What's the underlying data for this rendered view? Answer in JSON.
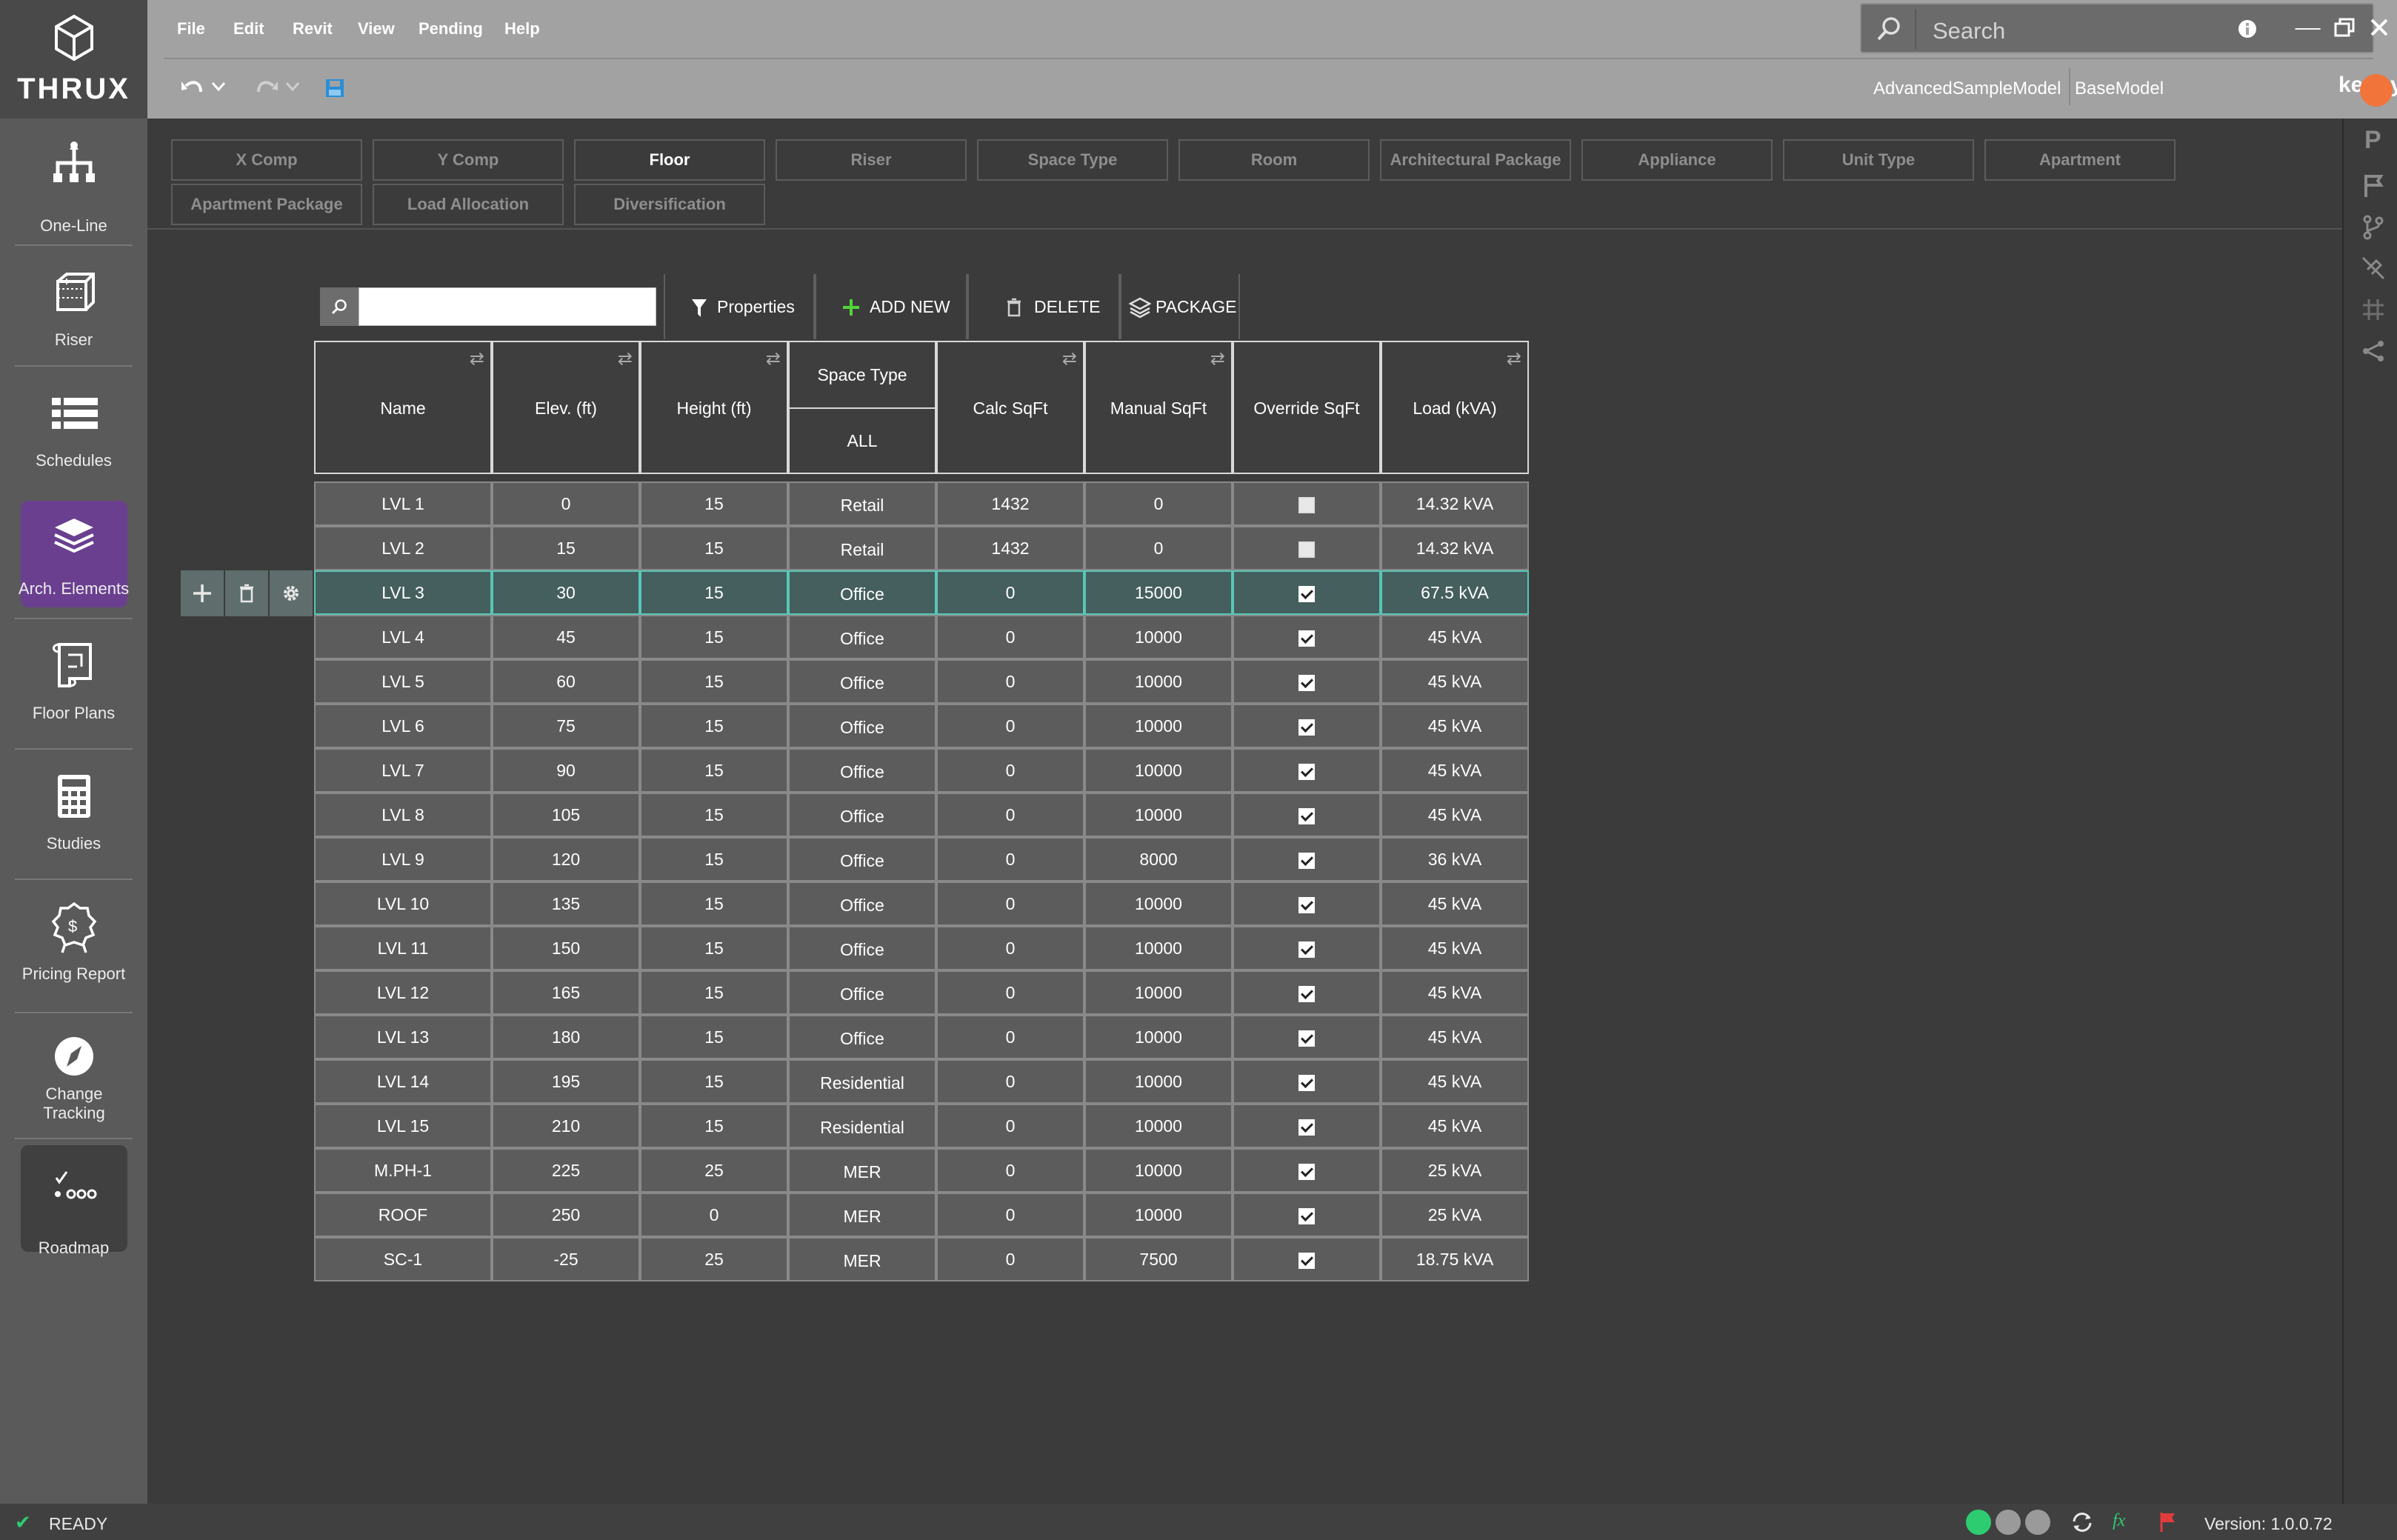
{
  "app": {
    "brand": "THRUX",
    "menu": [
      "File",
      "Edit",
      "Revit",
      "View",
      "Pending",
      "Help"
    ],
    "search_placeholder": "Search",
    "models": [
      "AdvancedSampleModel",
      "BaseModel"
    ],
    "user": "kennytanggg",
    "accent": "#6a3f8f",
    "selection_color": "#59c6b6"
  },
  "sidebar": [
    {
      "label": "One-Line",
      "icon": "one-line-icon"
    },
    {
      "label": "Riser",
      "icon": "riser-icon"
    },
    {
      "label": "Schedules",
      "icon": "schedules-icon"
    },
    {
      "label": "Arch. Elements",
      "icon": "arch-elements-icon",
      "active": true
    },
    {
      "label": "Floor Plans",
      "icon": "floor-plans-icon"
    },
    {
      "label": "Studies",
      "icon": "calculator-icon"
    },
    {
      "label": "Pricing Report",
      "icon": "pricing-report-icon"
    },
    {
      "label": "Change Tracking",
      "icon": "compass-icon"
    },
    {
      "label": "Roadmap",
      "icon": "roadmap-icon"
    }
  ],
  "tabs": {
    "row1": [
      "X Comp",
      "Y Comp",
      "Floor",
      "Riser",
      "Space Type",
      "Room",
      "Architectural Package",
      "Appliance",
      "Unit Type",
      "Apartment"
    ],
    "row2": [
      "Apartment Package",
      "Load Allocation",
      "Diversification"
    ],
    "active": "Floor"
  },
  "toolbar": {
    "properties": "Properties",
    "add_new": "ADD NEW",
    "delete": "DELETE",
    "package": "PACKAGE"
  },
  "table": {
    "columns": [
      "Name",
      "Elev. (ft)",
      "Height (ft)",
      "Space Type",
      "Calc SqFt",
      "Manual SqFt",
      "Override SqFt",
      "Load (kVA)"
    ],
    "space_type_filter": "ALL",
    "selected_row": 2,
    "rows": [
      {
        "name": "LVL 1",
        "elev": "0",
        "height": "15",
        "space": "Retail",
        "calc": "1432",
        "manual": "0",
        "override": false,
        "load": "14.32 kVA"
      },
      {
        "name": "LVL 2",
        "elev": "15",
        "height": "15",
        "space": "Retail",
        "calc": "1432",
        "manual": "0",
        "override": false,
        "load": "14.32 kVA"
      },
      {
        "name": "LVL 3",
        "elev": "30",
        "height": "15",
        "space": "Office",
        "calc": "0",
        "manual": "15000",
        "override": true,
        "load": "67.5 kVA"
      },
      {
        "name": "LVL 4",
        "elev": "45",
        "height": "15",
        "space": "Office",
        "calc": "0",
        "manual": "10000",
        "override": true,
        "load": "45 kVA"
      },
      {
        "name": "LVL 5",
        "elev": "60",
        "height": "15",
        "space": "Office",
        "calc": "0",
        "manual": "10000",
        "override": true,
        "load": "45 kVA"
      },
      {
        "name": "LVL 6",
        "elev": "75",
        "height": "15",
        "space": "Office",
        "calc": "0",
        "manual": "10000",
        "override": true,
        "load": "45 kVA"
      },
      {
        "name": "LVL 7",
        "elev": "90",
        "height": "15",
        "space": "Office",
        "calc": "0",
        "manual": "10000",
        "override": true,
        "load": "45 kVA"
      },
      {
        "name": "LVL 8",
        "elev": "105",
        "height": "15",
        "space": "Office",
        "calc": "0",
        "manual": "10000",
        "override": true,
        "load": "45 kVA"
      },
      {
        "name": "LVL 9",
        "elev": "120",
        "height": "15",
        "space": "Office",
        "calc": "0",
        "manual": "8000",
        "override": true,
        "load": "36 kVA"
      },
      {
        "name": "LVL 10",
        "elev": "135",
        "height": "15",
        "space": "Office",
        "calc": "0",
        "manual": "10000",
        "override": true,
        "load": "45 kVA"
      },
      {
        "name": "LVL 11",
        "elev": "150",
        "height": "15",
        "space": "Office",
        "calc": "0",
        "manual": "10000",
        "override": true,
        "load": "45 kVA"
      },
      {
        "name": "LVL 12",
        "elev": "165",
        "height": "15",
        "space": "Office",
        "calc": "0",
        "manual": "10000",
        "override": true,
        "load": "45 kVA"
      },
      {
        "name": "LVL 13",
        "elev": "180",
        "height": "15",
        "space": "Office",
        "calc": "0",
        "manual": "10000",
        "override": true,
        "load": "45 kVA"
      },
      {
        "name": "LVL 14",
        "elev": "195",
        "height": "15",
        "space": "Residential",
        "calc": "0",
        "manual": "10000",
        "override": true,
        "load": "45 kVA"
      },
      {
        "name": "LVL 15",
        "elev": "210",
        "height": "15",
        "space": "Residential",
        "calc": "0",
        "manual": "10000",
        "override": true,
        "load": "45 kVA"
      },
      {
        "name": "M.PH-1",
        "elev": "225",
        "height": "25",
        "space": "MER",
        "calc": "0",
        "manual": "10000",
        "override": true,
        "load": "25 kVA"
      },
      {
        "name": "ROOF",
        "elev": "250",
        "height": "0",
        "space": "MER",
        "calc": "0",
        "manual": "10000",
        "override": true,
        "load": "25 kVA"
      },
      {
        "name": "SC-1",
        "elev": "-25",
        "height": "25",
        "space": "MER",
        "calc": "0",
        "manual": "7500",
        "override": true,
        "load": "18.75 kVA"
      }
    ]
  },
  "status": {
    "text": "READY",
    "version": "Version: 1.0.0.72"
  }
}
